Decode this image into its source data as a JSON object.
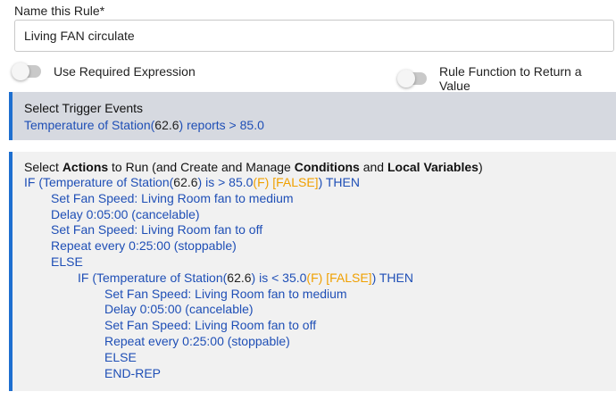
{
  "name_section": {
    "label": "Name this Rule*",
    "value": "Living FAN circulate"
  },
  "toggles": {
    "required_expression": {
      "label": "Use Required Expression",
      "on": false
    },
    "rule_function": {
      "label": "Rule Function to Return a Value",
      "on": false
    }
  },
  "trigger": {
    "title": "Select Trigger Events",
    "event_prefix": "Temperature of Station(",
    "event_value": "62.6",
    "event_suffix": ") reports > 85.0"
  },
  "actions": {
    "title_parts": {
      "t1": "Select ",
      "t2": "Actions",
      "t3": " to Run (and Create and Manage ",
      "t4": "Conditions",
      "t5": " and ",
      "t6": "Local Variables",
      "t7": ")"
    },
    "if1": {
      "prefix": "IF (Temperature of Station(",
      "value": "62.6",
      "mid": ") is > 85.0",
      "unit": "(F)",
      "state": " [FALSE]",
      "suffix": ") THEN"
    },
    "block1": [
      "Set Fan Speed: Living Room fan to medium",
      "Delay 0:05:00 (cancelable)",
      "Set Fan Speed: Living Room fan to off",
      "Repeat every 0:25:00 (stoppable)"
    ],
    "else1": "ELSE",
    "if2": {
      "prefix": "IF (Temperature of Station(",
      "value": "62.6",
      "mid": ") is < 35.0",
      "unit": "(F)",
      "state": " [FALSE]",
      "suffix": ") THEN"
    },
    "block2": [
      "Set Fan Speed: Living Room fan to medium",
      "Delay 0:05:00 (cancelable)",
      "Set Fan Speed: Living Room fan to off",
      "Repeat every 0:25:00 (stoppable)"
    ],
    "else2": "ELSE",
    "end": "END-REP"
  },
  "colors": {
    "accent": "#1e6fd0",
    "link": "#1f4fb6",
    "state": "#f0a000",
    "trigger_bg": "#d6d9e0",
    "actions_bg": "#f1f1f1"
  }
}
